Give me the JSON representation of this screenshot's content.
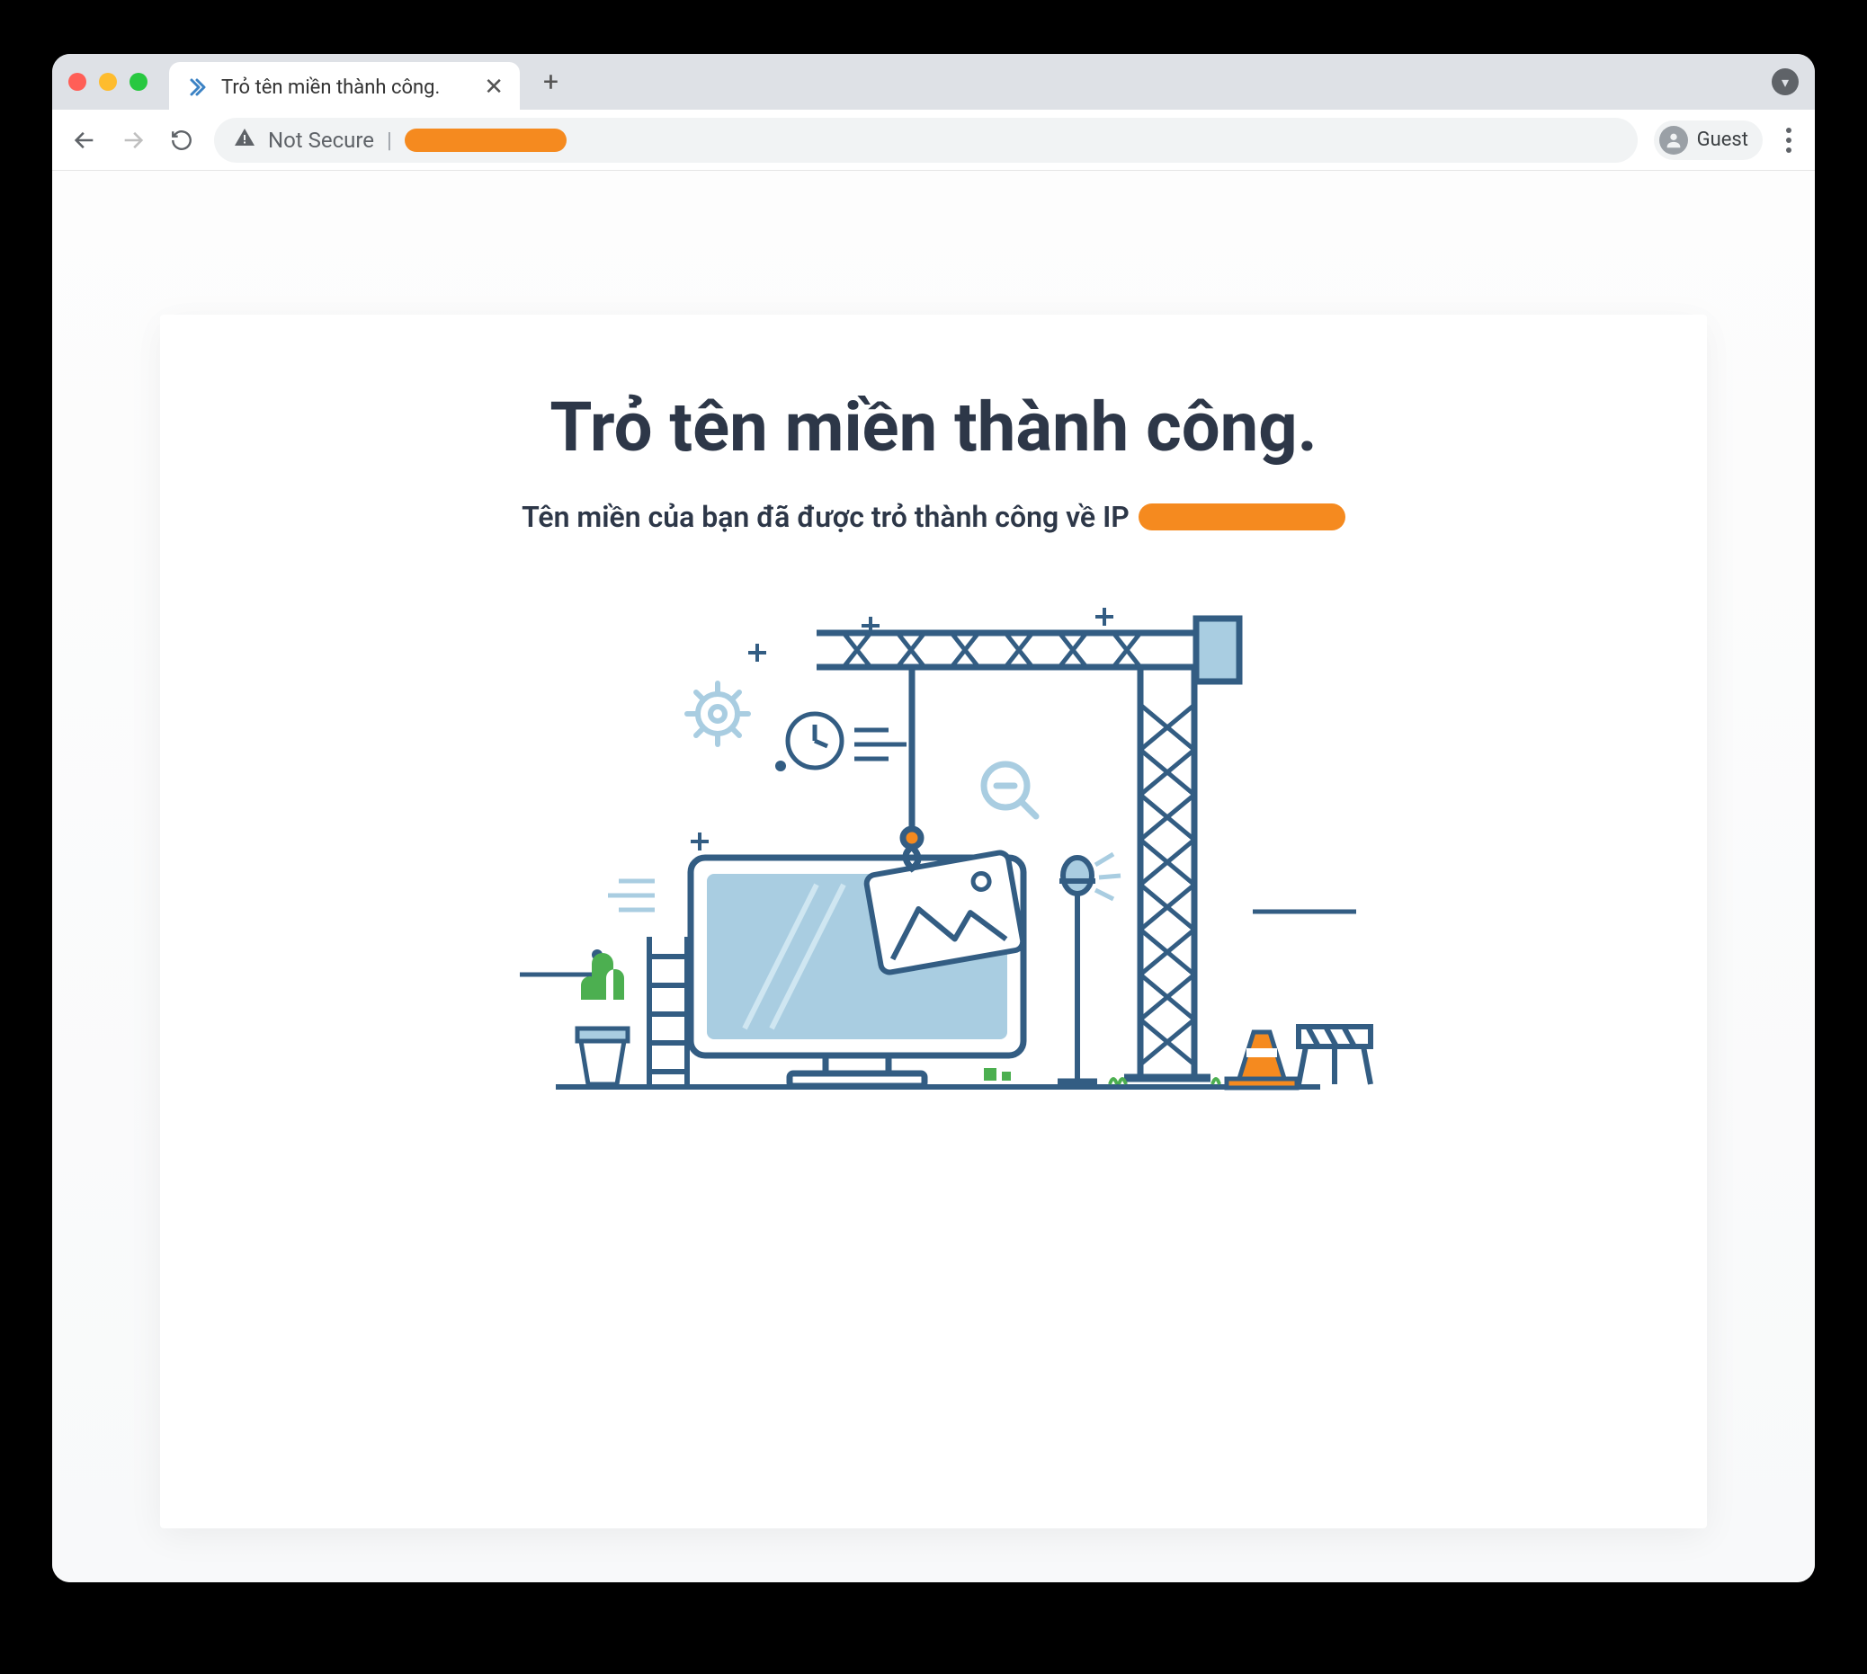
{
  "browser": {
    "tab_title": "Trỏ tên miền thành công.",
    "address_security_label": "Not Secure",
    "profile_label": "Guest"
  },
  "page": {
    "heading": "Trỏ tên miền thành công.",
    "subheading": "Tên miền của bạn đã được trỏ thành công về IP"
  },
  "icons": {
    "favicon": "chevrons-right-icon",
    "close": "✕",
    "plus": "+",
    "caret_down": "▾",
    "warning": "⚠"
  },
  "colors": {
    "accent_orange": "#f58a1f",
    "stroke_blue": "#335d83",
    "fill_blue": "#a9cde1",
    "green": "#4caf50"
  }
}
